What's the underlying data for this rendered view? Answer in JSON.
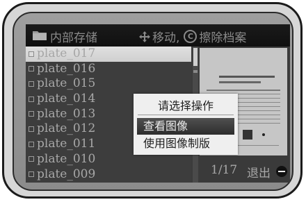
{
  "header": {
    "storage_title": "内部存储",
    "move_label": "移动,",
    "copy_symbol": "C",
    "delete_label": "擦除档案"
  },
  "files": [
    {
      "name": "plate_017",
      "selected": true
    },
    {
      "name": "plate_016",
      "selected": false
    },
    {
      "name": "plate_015",
      "selected": false
    },
    {
      "name": "plate_014",
      "selected": false
    },
    {
      "name": "plate_013",
      "selected": false
    },
    {
      "name": "plate_012",
      "selected": false
    },
    {
      "name": "plate_011",
      "selected": false
    },
    {
      "name": "plate_010",
      "selected": false
    },
    {
      "name": "plate_009",
      "selected": false
    }
  ],
  "preview": {
    "page_counter": "1/17",
    "exit_label": "退出"
  },
  "dialog": {
    "title": "请选择操作",
    "options": [
      "查看图像",
      "使用图像制版"
    ]
  },
  "colors": {
    "screen_bg": "#3b3b3b",
    "header_bg": "#141414",
    "selected_row": "#d8d8d8",
    "dialog_bg": "#efefef",
    "highlight": "#3a3a3a"
  }
}
